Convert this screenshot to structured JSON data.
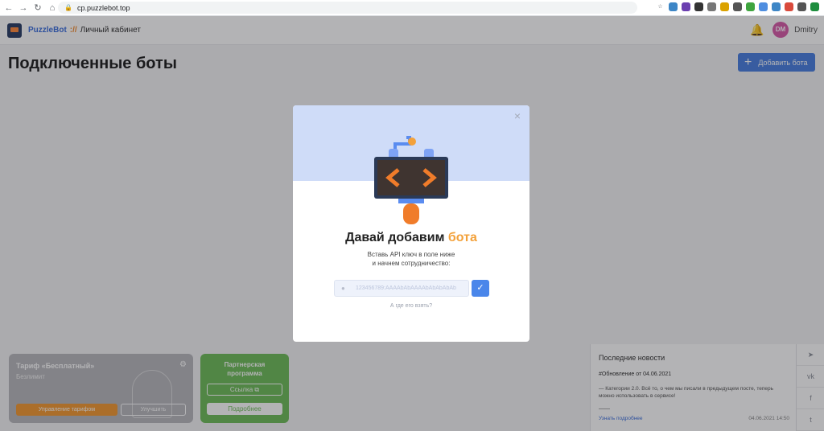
{
  "browser": {
    "url": "cp.puzzlebot.top",
    "extensions": [
      {
        "icon": "star-icon",
        "color": "#ffffff"
      },
      {
        "icon": "extension-blue-icon",
        "color": "#3d86c6"
      },
      {
        "icon": "extension-purple-icon",
        "color": "#6b3fb0"
      },
      {
        "icon": "extension-dark-icon",
        "color": "#333333"
      },
      {
        "icon": "camera-icon",
        "color": "#777777"
      },
      {
        "icon": "pin-icon",
        "color": "#dba200"
      },
      {
        "icon": "doc-icon",
        "color": "#555555"
      },
      {
        "icon": "green-icon",
        "color": "#3fa53f"
      },
      {
        "icon": "blue-icon",
        "color": "#4f8ee0"
      },
      {
        "icon": "cloud-icon",
        "color": "#3d86c6"
      },
      {
        "icon": "translate-icon",
        "color": "#d94a3c"
      },
      {
        "icon": "puzzle-icon",
        "color": "#555555"
      },
      {
        "icon": "profile-icon",
        "color": "#1e8e3e"
      }
    ]
  },
  "header": {
    "brand": "PuzzleBot",
    "separator": "://",
    "subtitle": "Личный кабинет",
    "user_initials": "DM",
    "username": "Dmitry"
  },
  "page": {
    "title": "Подключенные боты",
    "add_bot_label": "Добавить бота"
  },
  "tariff": {
    "title": "Тариф «Бесплатный»",
    "subtitle": "Безлимит",
    "manage_label": "Управление тарифом",
    "upgrade_label": "Улучшить"
  },
  "partner": {
    "title_line1": "Партнерская",
    "title_line2": "программа",
    "link_label": "Ссылка",
    "more_label": "Подробнее"
  },
  "news": {
    "title": "Последние новости",
    "tag": "#Обновление от 04.06.2021",
    "body": "— Категории 2.0. Всё то, о чем мы писали в предыдущем посте, теперь можно использовать в сервисе!",
    "dash": "——",
    "more": "Узнать подробнее",
    "date": "04.06.2021 14:50"
  },
  "social": [
    "telegram-icon",
    "vk-icon",
    "facebook-icon",
    "twitter-icon"
  ],
  "modal": {
    "heading_main": "Давай добавим",
    "heading_accent": "бота",
    "desc_line1": "Вставь API ключ в поле ниже",
    "desc_line2": "и начнем сотрудничество:",
    "token_placeholder": "123456789:AAAAbAbAAAAbAbAbAbAb",
    "where_label": "А где его взять?"
  }
}
